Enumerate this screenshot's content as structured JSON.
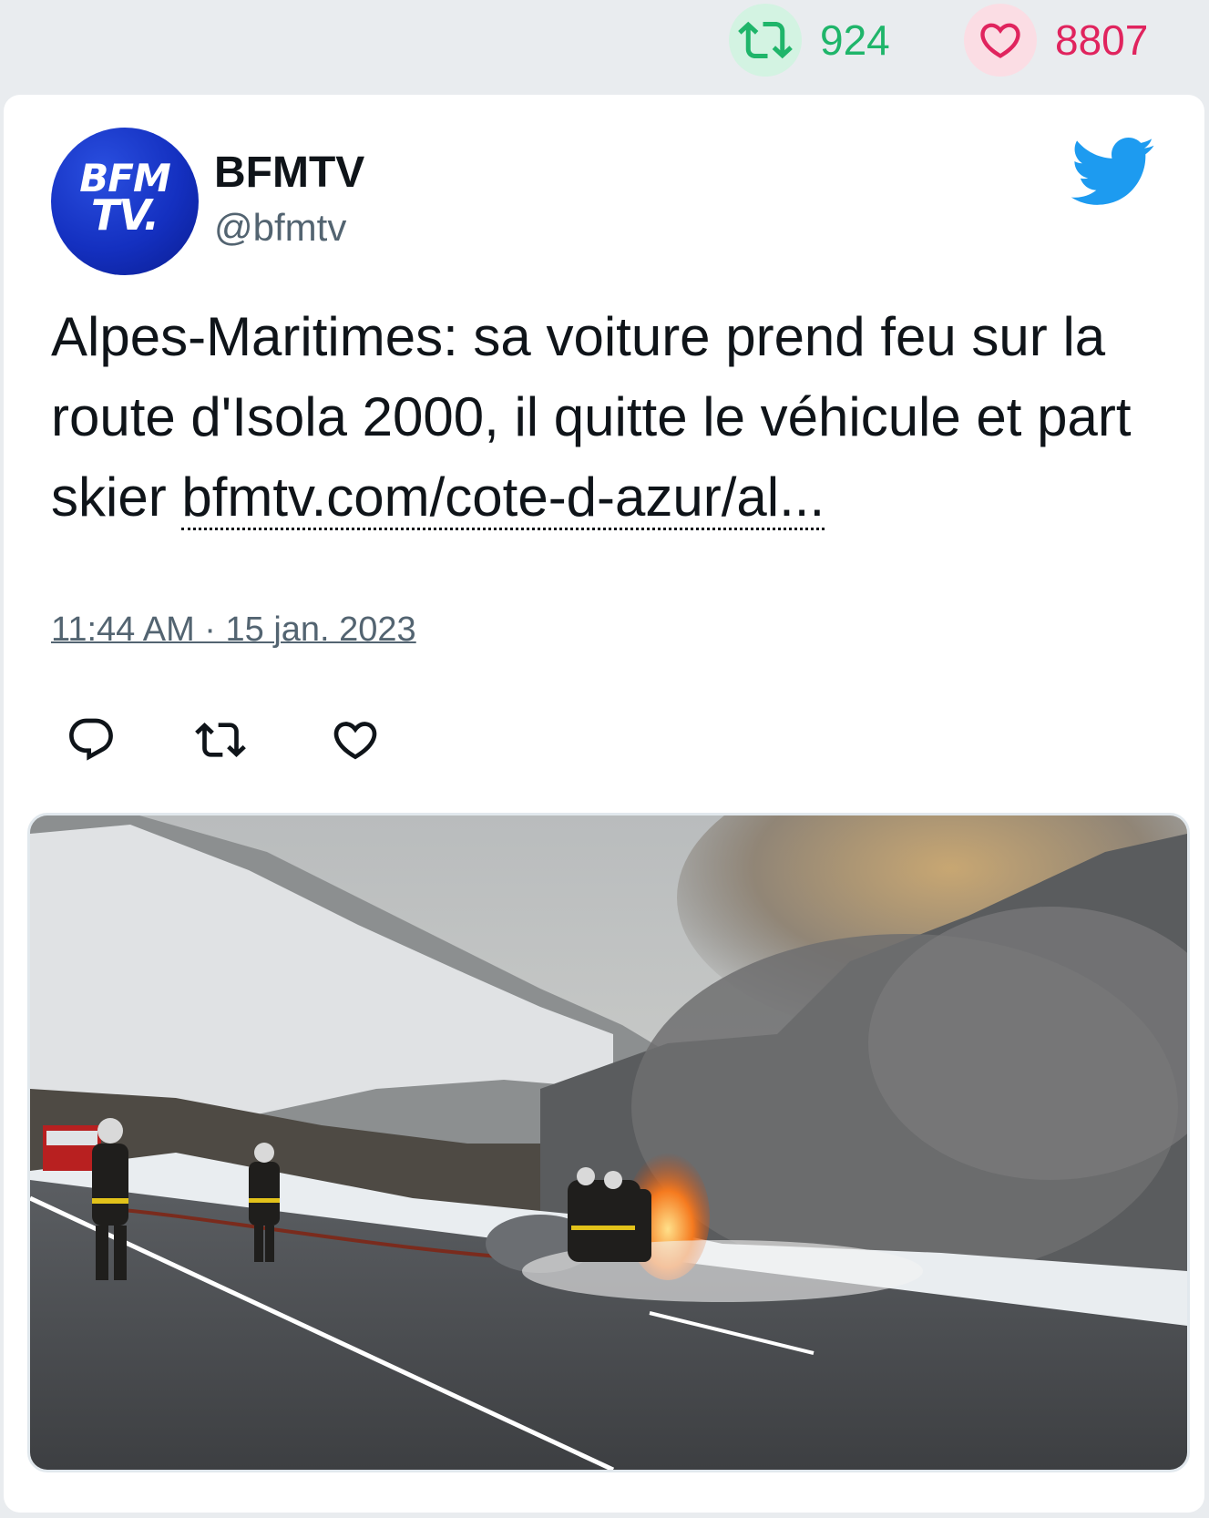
{
  "stats": {
    "retweets": "924",
    "likes": "8807",
    "retweet_color": "#1fb56a",
    "like_color": "#e0245e"
  },
  "tweet": {
    "avatar_logo_line1": "BFM",
    "avatar_logo_line2": "TV.",
    "name": "BFMTV",
    "handle": "@bfmtv",
    "text": "Alpes-Maritimes: sa voiture prend feu sur la route d'Isola 2000, il quitte le véhicule et part skier ",
    "link": "bfmtv.com/cote-d-azur/al...",
    "timestamp": "11:44 AM · 15 jan. 2023",
    "icons": [
      "retweet-icon",
      "heart-icon",
      "twitter-bird-icon",
      "reply-icon",
      "retweet-icon",
      "like-icon"
    ]
  },
  "colors": {
    "background": "#e9ecef",
    "card": "#ffffff",
    "twitter_blue": "#1d9bf0",
    "secondary_text": "#536471"
  }
}
